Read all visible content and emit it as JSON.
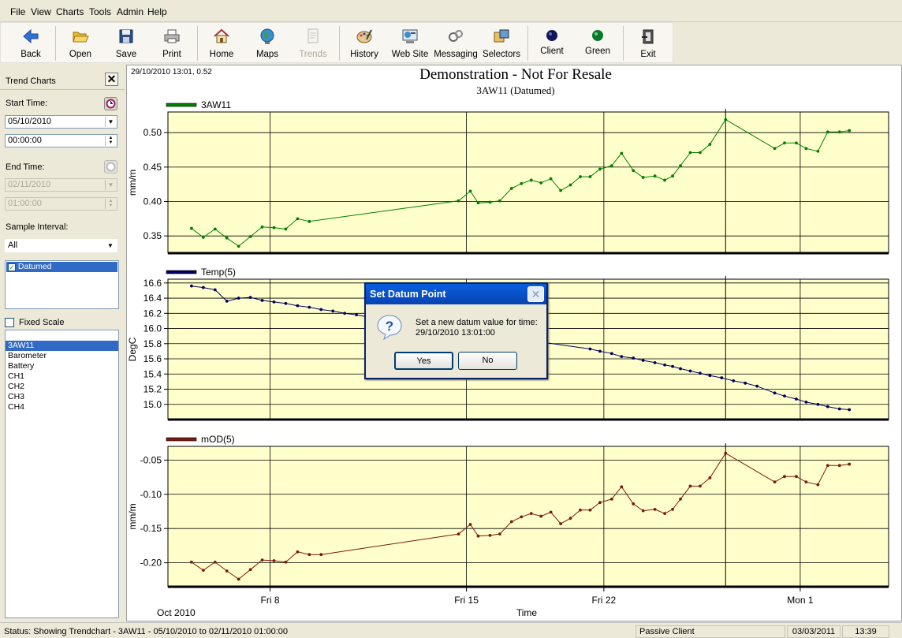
{
  "menu": [
    "File",
    "View",
    "Charts",
    "Tools",
    "Admin",
    "Help"
  ],
  "toolbar": [
    {
      "label": "Back",
      "icon": "back-arrow-icon",
      "enabled": true
    },
    {
      "label": "Open",
      "icon": "open-folder-icon",
      "enabled": true
    },
    {
      "label": "Save",
      "icon": "save-disk-icon",
      "enabled": true
    },
    {
      "label": "Print",
      "icon": "printer-icon",
      "enabled": true
    },
    {
      "label": "Home",
      "icon": "home-icon",
      "enabled": true
    },
    {
      "label": "Maps",
      "icon": "globe-icon",
      "enabled": true
    },
    {
      "label": "Trends",
      "icon": "trends-doc-icon",
      "enabled": false
    },
    {
      "label": "History",
      "icon": "history-palette-icon",
      "enabled": true
    },
    {
      "label": "Web Site",
      "icon": "website-icon",
      "enabled": true
    },
    {
      "label": "Messaging",
      "icon": "messaging-icon",
      "enabled": true
    },
    {
      "label": "Selectors",
      "icon": "selectors-icon",
      "enabled": true
    },
    {
      "label": "Client",
      "icon": "client-dot-icon",
      "enabled": true
    },
    {
      "label": "Green",
      "icon": "green-dot-icon",
      "enabled": true
    },
    {
      "label": "Exit",
      "icon": "exit-icon",
      "enabled": true
    }
  ],
  "panel": {
    "title": "Trend Charts",
    "start_time_label": "Start Time:",
    "start_date": "05/10/2010",
    "start_time": "00:00:00",
    "end_time_label": "End Time:",
    "end_date": "02/11/2010",
    "end_time": "01:00:00",
    "sample_interval_label": "Sample Interval:",
    "sample_interval": "All",
    "options": [
      {
        "label": "Datumed",
        "checked": true
      }
    ],
    "fixed_scale_label": "Fixed Scale",
    "channels": [
      "3AW11",
      "Barometer",
      "Battery",
      "CH1",
      "CH2",
      "CH3",
      "CH4"
    ],
    "selected_channel": "3AW11"
  },
  "chart_header": {
    "cursor_readout": "29/10/2010 13:01, 0.52",
    "title": "Demonstration - Not For Resale",
    "subtitle": "3AW11 (Datumed)"
  },
  "colors": {
    "plot_bg": "#ffffcc",
    "series1": "#008000",
    "series2": "#000060",
    "series3": "#7a1a10"
  },
  "chart_data": [
    {
      "type": "line",
      "series": [
        {
          "name": "3AW11",
          "color": "#008000"
        }
      ],
      "ylabel": "mm/m",
      "yticks": [
        "0.50",
        "0.45",
        "0.40",
        "0.35"
      ],
      "ylim": [
        0.325,
        0.53
      ],
      "x": [
        0,
        0.6,
        1.2,
        1.8,
        2.4,
        3,
        3.6,
        4.2,
        4.8,
        5.4,
        6,
        13.6,
        14.2,
        14.6,
        15.2,
        15.7,
        16.3,
        16.8,
        17.3,
        17.8,
        18.3,
        18.8,
        19.3,
        19.8,
        20.3,
        20.8,
        21.4,
        21.9,
        22.5,
        23,
        23.6,
        24.1,
        24.5,
        24.9,
        25.4,
        25.9,
        26.4,
        27.2,
        29.7,
        30.2,
        30.8,
        31.3,
        31.9,
        32.4,
        33,
        33.5
      ],
      "values": [
        0.361,
        0.348,
        0.36,
        0.347,
        0.335,
        0.349,
        0.363,
        0.362,
        0.36,
        0.375,
        0.371,
        0.401,
        0.415,
        0.398,
        0.399,
        0.401,
        0.419,
        0.426,
        0.431,
        0.427,
        0.433,
        0.416,
        0.424,
        0.436,
        0.436,
        0.447,
        0.452,
        0.47,
        0.445,
        0.435,
        0.437,
        0.431,
        0.437,
        0.452,
        0.471,
        0.471,
        0.483,
        0.519,
        0.477,
        0.485,
        0.485,
        0.477,
        0.473,
        0.501,
        0.501,
        0.503
      ]
    },
    {
      "type": "line",
      "series": [
        {
          "name": "Temp(5)",
          "color": "#000060"
        }
      ],
      "ylabel": "DegC",
      "yticks": [
        "16.6",
        "16.4",
        "16.2",
        "16.0",
        "15.8",
        "15.6",
        "15.4",
        "15.2",
        "15.0"
      ],
      "ylim": [
        14.8,
        16.65
      ],
      "x": [
        0,
        0.6,
        1.2,
        1.8,
        2.4,
        3,
        3.6,
        4.2,
        4.8,
        5.4,
        6,
        6.6,
        7.2,
        7.8,
        8.4,
        9,
        9.6,
        10.2,
        20.3,
        20.8,
        21.4,
        21.9,
        22.5,
        23,
        23.6,
        24.1,
        24.5,
        24.9,
        25.4,
        25.9,
        26.4,
        27,
        27.6,
        28.2,
        28.8,
        29.7,
        30.2,
        30.8,
        31.3,
        31.9,
        32.4,
        33,
        33.5
      ],
      "values": [
        16.56,
        16.54,
        16.51,
        16.36,
        16.4,
        16.41,
        16.37,
        16.35,
        16.33,
        16.3,
        16.28,
        16.25,
        16.23,
        16.2,
        16.18,
        16.15,
        16.13,
        16.1,
        15.73,
        15.7,
        15.67,
        15.63,
        15.61,
        15.58,
        15.55,
        15.52,
        15.5,
        15.47,
        15.44,
        15.41,
        15.38,
        15.35,
        15.31,
        15.28,
        15.24,
        15.15,
        15.11,
        15.07,
        15.03,
        15.0,
        14.97,
        14.94,
        14.93
      ]
    },
    {
      "type": "line",
      "series": [
        {
          "name": "mOD(5)",
          "color": "#7a1a10"
        }
      ],
      "ylabel": "mm/m",
      "yticks": [
        "-0.05",
        "-0.10",
        "-0.15",
        "-0.20"
      ],
      "ylim": [
        -0.235,
        -0.03
      ],
      "x": [
        0,
        0.6,
        1.2,
        1.8,
        2.4,
        3,
        3.6,
        4.2,
        4.8,
        5.4,
        6,
        6.6,
        13.6,
        14.2,
        14.6,
        15.2,
        15.7,
        16.3,
        16.8,
        17.3,
        17.8,
        18.3,
        18.8,
        19.3,
        19.8,
        20.3,
        20.8,
        21.4,
        21.9,
        22.5,
        23,
        23.6,
        24.1,
        24.5,
        24.9,
        25.4,
        25.9,
        26.4,
        27.2,
        29.7,
        30.2,
        30.8,
        31.3,
        31.9,
        32.4,
        33,
        33.5
      ],
      "values": [
        -0.199,
        -0.211,
        -0.199,
        -0.212,
        -0.224,
        -0.21,
        -0.196,
        -0.197,
        -0.199,
        -0.184,
        -0.188,
        -0.188,
        -0.158,
        -0.144,
        -0.161,
        -0.16,
        -0.158,
        -0.14,
        -0.133,
        -0.128,
        -0.132,
        -0.126,
        -0.143,
        -0.135,
        -0.123,
        -0.123,
        -0.112,
        -0.107,
        -0.089,
        -0.114,
        -0.124,
        -0.122,
        -0.128,
        -0.122,
        -0.107,
        -0.088,
        -0.088,
        -0.076,
        -0.04,
        -0.082,
        -0.074,
        -0.074,
        -0.082,
        -0.086,
        -0.058,
        -0.058,
        -0.056
      ]
    }
  ],
  "x_axis": {
    "label": "Time",
    "origin_label": "Oct 2010",
    "ticks": [
      {
        "x": 4,
        "label": "Fri 8"
      },
      {
        "x": 14,
        "label": "Fri 15"
      },
      {
        "x": 21,
        "label": "Fri 22"
      },
      {
        "x": 31,
        "label": "Mon 1"
      }
    ],
    "range": [
      -1.2,
      35.5
    ],
    "cursor_x": 27.2
  },
  "dialog": {
    "title": "Set Datum Point",
    "message": "Set a new datum value for time:",
    "time": "29/10/2010 13:01:00",
    "yes_label": "Yes",
    "no_label": "No"
  },
  "status": {
    "text": "Status: Showing Trendchart - 3AW11 - 05/10/2010 to 02/11/2010 01:00:00",
    "mode": "Passive Client",
    "date": "03/03/2011",
    "time": "13:39"
  }
}
